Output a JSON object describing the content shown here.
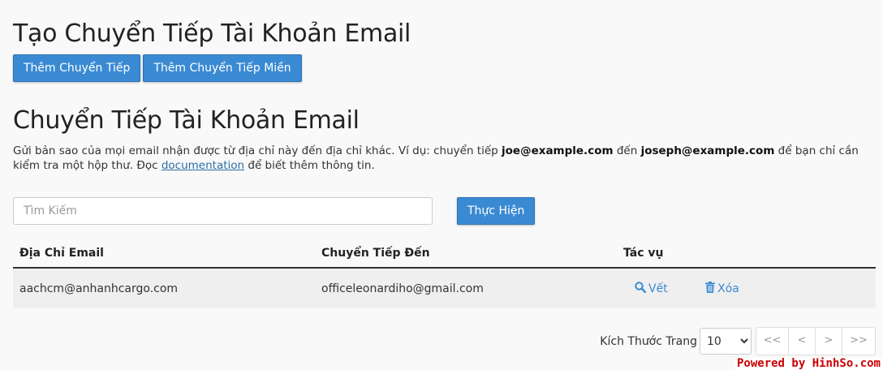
{
  "page_title": "Tạo Chuyển Tiếp Tài Khoản Email",
  "buttons": {
    "add_forwarder": "Thêm Chuyển Tiếp",
    "add_domain_forwarder": "Thêm Chuyển Tiếp Miền"
  },
  "section_title": "Chuyển Tiếp Tài Khoản Email",
  "description": {
    "part1": "Gửi bản sao của mọi email nhận được từ địa chỉ này đến địa chỉ khác. Ví dụ: chuyển tiếp ",
    "example_from": "joe@example.com",
    "part2": " đến ",
    "example_to": "joseph@example.com",
    "part3": " để bạn chỉ cần kiểm tra một hộp thư. Đọc ",
    "link": "documentation",
    "part4": " để biết thêm thông tin."
  },
  "search": {
    "placeholder": "Tìm Kiếm",
    "go_label": "Thực Hiện"
  },
  "table": {
    "headers": [
      "Địa Chỉ Email",
      "Chuyển Tiếp Đến",
      "Tác vụ"
    ],
    "rows": [
      {
        "email": "aachcm@anhanhcargo.com",
        "forward_to": "officeleonardiho@gmail.com",
        "trace_label": "Vết",
        "delete_label": "Xóa"
      }
    ]
  },
  "pagination": {
    "page_size_label": "Kích Thước Trang",
    "page_size_value": "10",
    "first": "<<",
    "prev": "<",
    "next": ">",
    "last": ">>"
  },
  "watermark": "Powered by HinhSo.com",
  "colors": {
    "primary_button": "#3a8ad3",
    "link": "#2a6ea8",
    "watermark": "#cc0000"
  }
}
